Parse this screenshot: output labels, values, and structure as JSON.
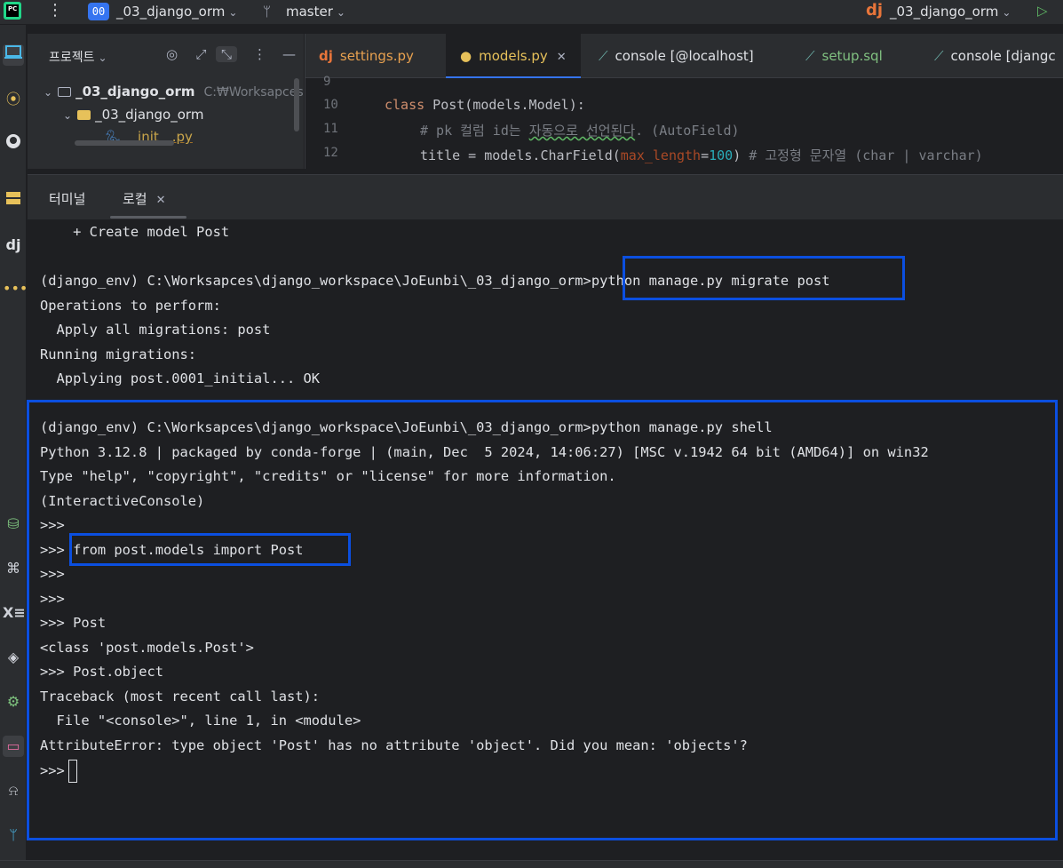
{
  "titlebar": {
    "project_badge": "00",
    "project_name": "_03_django_orm",
    "branch": "master",
    "run_config": "_03_django_orm"
  },
  "project_panel": {
    "title": "프로젝트",
    "tree": [
      {
        "name": "_03_django_orm",
        "path": "C:₩Worksapces"
      },
      {
        "name": "_03_django_orm"
      },
      {
        "name": "__init__.py"
      }
    ]
  },
  "editor": {
    "tabs": [
      {
        "label": "settings.py"
      },
      {
        "label": "models.py"
      },
      {
        "label": "console [@localhost]"
      },
      {
        "label": "setup.sql"
      },
      {
        "label": "console [djangc"
      }
    ],
    "active_tab": "models.py",
    "line_numbers": [
      "9",
      "10",
      "11",
      "12"
    ],
    "code": {
      "line10_kw": "class",
      "line10_rest": " Post(models.Model):",
      "line11_a": "# pk 컬럼 id는 ",
      "line11_b": "자동으로 선언된다",
      "line11_c": ". (AutoField)",
      "line12_a": "title = models.CharField(",
      "line12_arg": "max_length",
      "line12_eq": "=",
      "line12_num": "100",
      "line12_b": ") ",
      "line12_comment": "# 고정형 문자열 (char | varchar)"
    }
  },
  "terminal": {
    "tabs": [
      {
        "label": "터미널"
      },
      {
        "label": "로컬"
      }
    ],
    "lines": [
      "    + Create model Post",
      "",
      "(django_env) C:\\Worksapces\\django_workspace\\JoEunbi\\_03_django_orm>python manage.py migrate post",
      "Operations to perform:",
      "  Apply all migrations: post",
      "Running migrations:",
      "  Applying post.0001_initial... OK",
      "",
      "(django_env) C:\\Worksapces\\django_workspace\\JoEunbi\\_03_django_orm>python manage.py shell",
      "Python 3.12.8 | packaged by conda-forge | (main, Dec  5 2024, 14:06:27) [MSC v.1942 64 bit (AMD64)] on win32",
      "Type \"help\", \"copyright\", \"credits\" or \"license\" for more information.",
      "(InteractiveConsole)",
      ">>>",
      ">>> from post.models import Post",
      ">>>",
      ">>>",
      ">>> Post",
      "<class 'post.models.Post'>",
      ">>> Post.object",
      "Traceback (most recent call last):",
      "  File \"<console>\", line 1, in <module>",
      "AttributeError: type object 'Post' has no attribute 'object'. Did you mean: 'objects'?",
      ">>>"
    ]
  },
  "colors": {
    "highlight_box": "#0b4fe0",
    "background": "#1e1f22",
    "panel": "#2b2d30",
    "accent": "#3574f0"
  },
  "icons": {
    "toolstrip": [
      "computer-icon",
      "commit-icon",
      "github-icon",
      "structure-icon",
      "django-icon",
      "more-icon",
      "database-add-icon",
      "python-console-icon",
      "excel-icon",
      "layers-icon",
      "settings-icon",
      "terminal-icon",
      "notifications-icon",
      "git-icon"
    ]
  }
}
